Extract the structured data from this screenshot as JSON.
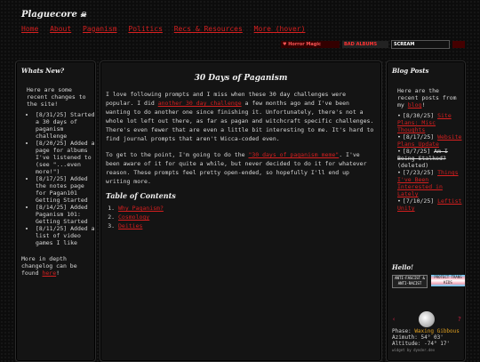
{
  "header": {
    "title": "Plaguecore",
    "title_icon": "skull-icon",
    "nav": [
      "Home",
      "About",
      "Paganism",
      "Politics",
      "Recs & Resources",
      "More (hover)"
    ],
    "buttons": [
      "♥ Horror Magic",
      "BAD ALBUMS",
      "SCREAM"
    ]
  },
  "left": {
    "heading": "Whats New?",
    "intro": "Here are some recent changes to the site!",
    "changes": [
      "[8/31/25] Started a 30 days of paganism challenge",
      "[8/20/25] Added a page for albums I've listened to (see \"...even more!\")",
      "[8/17/25] Added the notes page for Pagan101 Getting Started",
      "[8/14/25] Added Paganism 101: Getting Started",
      "[8/11/25] Added a list of video games I like"
    ],
    "outro_before": "More in depth changelog can be found ",
    "outro_link": "here",
    "outro_after": "!"
  },
  "main": {
    "title": "30 Days of Paganism",
    "p1_a": "I love following prompts and I miss when these 30 day challenges were popular. I did ",
    "p1_link": "another 30 day challenge",
    "p1_b": " a few months ago and I've been wanting to do another one since finishing it. Unfortunately, there's not a whole lot left out there, as far as pagan and witchcraft specific challenges. There's even fewer that are even a little bit interesting to me. It's hard to find journal prompts that aren't Wicca-coded even.",
    "p2_a": "To get to the point, I'm going to do the ",
    "p2_link": "\"30 days of paganism meme\"",
    "p2_b": ". I've been aware of it for quite a while, but never decided to do it for whatever reason. These prompts feel pretty open-ended, so hopefully I'll end up writing more.",
    "toc_heading": "Table of Contents",
    "toc": [
      "Why Paganism?",
      "Cosmology",
      "Deities"
    ]
  },
  "right": {
    "heading": "Blog Posts",
    "intro_before": "Here are the recent posts from my ",
    "intro_link": "blog",
    "intro_after": "!",
    "posts": [
      {
        "date": "[8/30/25]",
        "title": "Site Plans: Misc Thoughts",
        "strike": false
      },
      {
        "date": "[8/17/25]",
        "title": "Website Plans Update",
        "strike": false
      },
      {
        "date": "[8/7/25]",
        "title": "Am I Being Stalked?",
        "strike": true,
        "note": "(deleted)"
      },
      {
        "date": "[7/23/25]",
        "title": "Things I've Been Interested in Lately",
        "strike": false
      },
      {
        "date": "[7/10/25]",
        "title": "Leftist Unity",
        "strike": false
      }
    ],
    "hello_heading": "Hello!",
    "hello_buttons": [
      "ANTI-FASCIST & ANTI-RACIST",
      "PROTECT TRANS KIDS"
    ],
    "moon": {
      "prev": "‹",
      "next": "?",
      "phase_label": "Phase:",
      "phase": "Waxing Gibbous",
      "azimuth_label": "Azimuth:",
      "azimuth": "54° 03'",
      "altitude_label": "Altitude:",
      "altitude": "-74° 17'",
      "credit": "widget by dynder.dev"
    }
  },
  "colors": {
    "accent": "#d61f1f",
    "phase": "#e0a020"
  }
}
